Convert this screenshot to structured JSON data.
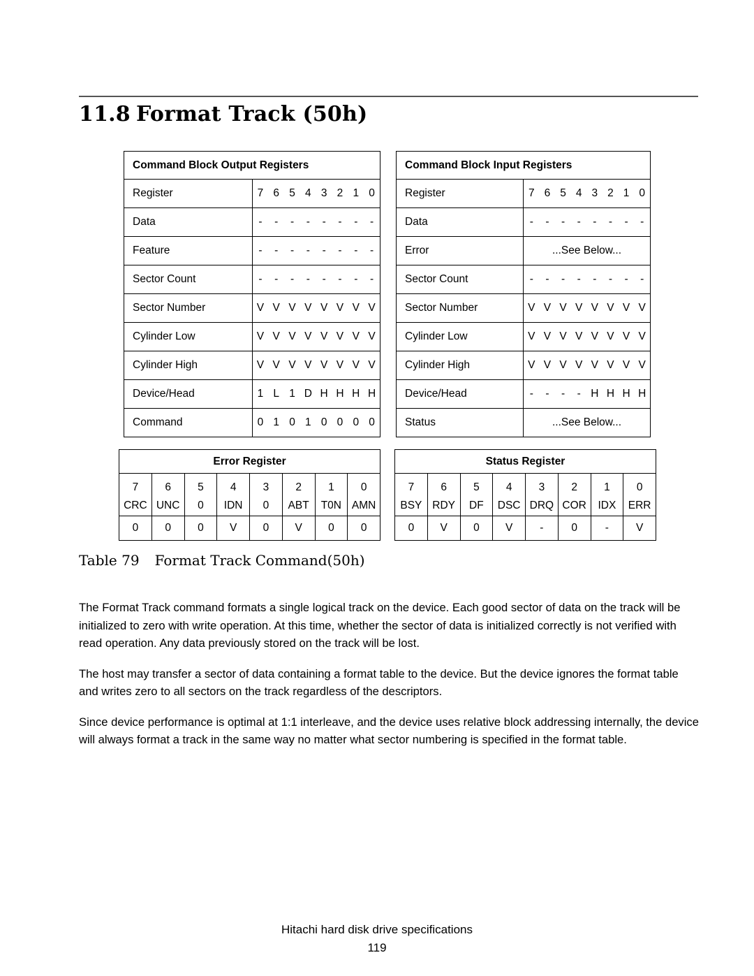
{
  "section": {
    "number": "11.8",
    "title": "Format Track (50h)"
  },
  "output_registers": {
    "header": "Command Block Output Registers",
    "bit_header_label": "Register",
    "bit_numbers": [
      "7",
      "6",
      "5",
      "4",
      "3",
      "2",
      "1",
      "0"
    ],
    "rows": [
      {
        "name": "Data",
        "bits": [
          "-",
          "-",
          "-",
          "-",
          "-",
          "-",
          "-",
          "-"
        ]
      },
      {
        "name": "Feature",
        "bits": [
          "-",
          "-",
          "-",
          "-",
          "-",
          "-",
          "-",
          "-"
        ]
      },
      {
        "name": "Sector Count",
        "bits": [
          "-",
          "-",
          "-",
          "-",
          "-",
          "-",
          "-",
          "-"
        ]
      },
      {
        "name": "Sector Number",
        "bits": [
          "V",
          "V",
          "V",
          "V",
          "V",
          "V",
          "V",
          "V"
        ]
      },
      {
        "name": "Cylinder Low",
        "bits": [
          "V",
          "V",
          "V",
          "V",
          "V",
          "V",
          "V",
          "V"
        ]
      },
      {
        "name": "Cylinder High",
        "bits": [
          "V",
          "V",
          "V",
          "V",
          "V",
          "V",
          "V",
          "V"
        ]
      },
      {
        "name": "Device/Head",
        "bits": [
          "1",
          "L",
          "1",
          "D",
          "H",
          "H",
          "H",
          "H"
        ]
      },
      {
        "name": "Command",
        "bits": [
          "0",
          "1",
          "0",
          "1",
          "0",
          "0",
          "0",
          "0"
        ]
      }
    ]
  },
  "input_registers": {
    "header": "Command Block Input Registers",
    "bit_header_label": "Register",
    "bit_numbers": [
      "7",
      "6",
      "5",
      "4",
      "3",
      "2",
      "1",
      "0"
    ],
    "rows": [
      {
        "name": "Data",
        "bits": [
          "-",
          "-",
          "-",
          "-",
          "-",
          "-",
          "-",
          "-"
        ]
      },
      {
        "name": "Error",
        "wide": "...See Below..."
      },
      {
        "name": "Sector Count",
        "bits": [
          "-",
          "-",
          "-",
          "-",
          "-",
          "-",
          "-",
          "-"
        ]
      },
      {
        "name": "Sector Number",
        "bits": [
          "V",
          "V",
          "V",
          "V",
          "V",
          "V",
          "V",
          "V"
        ]
      },
      {
        "name": "Cylinder Low",
        "bits": [
          "V",
          "V",
          "V",
          "V",
          "V",
          "V",
          "V",
          "V"
        ]
      },
      {
        "name": "Cylinder High",
        "bits": [
          "V",
          "V",
          "V",
          "V",
          "V",
          "V",
          "V",
          "V"
        ]
      },
      {
        "name": "Device/Head",
        "bits": [
          "-",
          "-",
          "-",
          "-",
          "H",
          "H",
          "H",
          "H"
        ]
      },
      {
        "name": "Status",
        "wide": "...See Below..."
      }
    ]
  },
  "error_register": {
    "header": "Error Register",
    "bit_numbers": [
      "7",
      "6",
      "5",
      "4",
      "3",
      "2",
      "1",
      "0"
    ],
    "bit_names": [
      "CRC",
      "UNC",
      "0",
      "IDN",
      "0",
      "ABT",
      "T0N",
      "AMN"
    ],
    "bit_values": [
      "0",
      "0",
      "0",
      "V",
      "0",
      "V",
      "0",
      "0"
    ]
  },
  "status_register": {
    "header": "Status Register",
    "bit_numbers": [
      "7",
      "6",
      "5",
      "4",
      "3",
      "2",
      "1",
      "0"
    ],
    "bit_names": [
      "BSY",
      "RDY",
      "DF",
      "DSC",
      "DRQ",
      "COR",
      "IDX",
      "ERR"
    ],
    "bit_values": [
      "0",
      "V",
      "0",
      "V",
      "-",
      "0",
      "-",
      "V"
    ]
  },
  "caption": {
    "label": "Table 79",
    "text": "Format Track Command(50h)"
  },
  "body": {
    "paragraphs": [
      "The Format Track command formats a single logical track on the device. Each good sector of data on the track will be initialized to zero with write operation. At this time, whether the sector of data is initialized correctly is not verified with read operation. Any data previously stored on the track will be lost.",
      "The host may transfer a sector of data containing a format table to the device. But the device ignores the format table and writes zero to all sectors on the track regardless of the descriptors.",
      "Since device performance is optimal at 1:1 interleave, and the device uses relative block addressing internally, the device will always format a track in the same way no matter what sector numbering is specified in the format table."
    ]
  },
  "footer": {
    "line1": "Hitachi hard disk drive specifications",
    "line2": "119"
  }
}
